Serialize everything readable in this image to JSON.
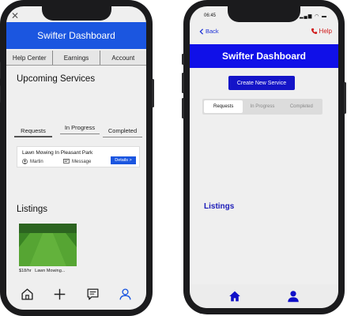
{
  "left_app": {
    "close_icon_glyph": "✕",
    "header_title": "Swifter Dashboard",
    "top_tabs": [
      "Help Center",
      "Earnings",
      "Account"
    ],
    "upcoming_title": "Upcoming Services",
    "sub_tabs": [
      "Requests",
      "In Progress",
      "Completed"
    ],
    "service_card": {
      "title": "Lawn Mowing In Pleasant Park",
      "person": "Martin",
      "message_label": "Message",
      "details_label": "Details >"
    },
    "listings_title": "Listings",
    "listing": {
      "price": "$18/hr",
      "name": "Lawn Mowing..."
    },
    "nav_icons": [
      "home-icon",
      "plus-icon",
      "message-icon",
      "profile-icon"
    ]
  },
  "right_app": {
    "status_time": "06:45",
    "status_icons": "▂▄▆ ◠ ▬",
    "back_label": "Back",
    "help_label": "Help",
    "header_title": "Swifter Dashboard",
    "create_button": "Create New Service",
    "segments": [
      "Requests",
      "In Progress",
      "Completed"
    ],
    "listings_title": "Listings",
    "nav_icons": [
      "home-icon",
      "profile-icon"
    ]
  },
  "colors": {
    "left_accent": "#1b56e0",
    "right_accent": "#1010e8",
    "help_red": "#d01818",
    "grass_green": "#4a9a2e"
  }
}
